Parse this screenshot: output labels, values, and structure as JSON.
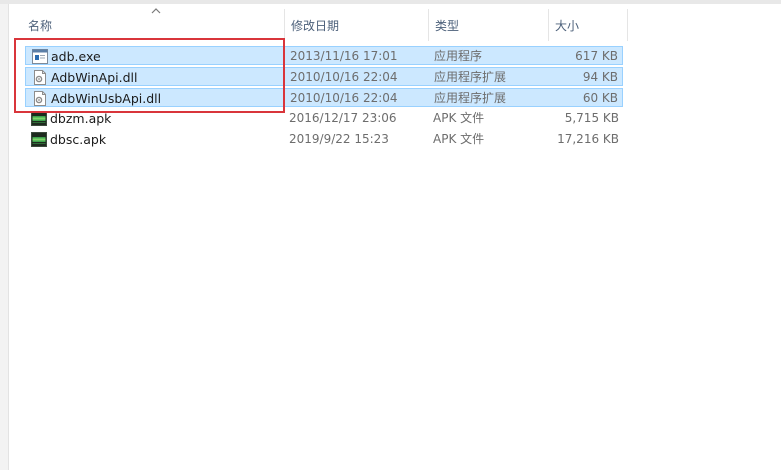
{
  "columns": {
    "name": "名称",
    "date": "修改日期",
    "type": "类型",
    "size": "大小"
  },
  "files": [
    {
      "name": "adb.exe",
      "date": "2013/11/16 17:01",
      "type": "应用程序",
      "size": "617 KB",
      "icon": "exe-icon",
      "selected": true
    },
    {
      "name": "AdbWinApi.dll",
      "date": "2010/10/16 22:04",
      "type": "应用程序扩展",
      "size": "94 KB",
      "icon": "dll-icon",
      "selected": true
    },
    {
      "name": "AdbWinUsbApi.dll",
      "date": "2010/10/16 22:04",
      "type": "应用程序扩展",
      "size": "60 KB",
      "icon": "dll-icon",
      "selected": true
    },
    {
      "name": "dbzm.apk",
      "date": "2016/12/17 23:06",
      "type": "APK 文件",
      "size": "5,715 KB",
      "icon": "apk-icon",
      "selected": false
    },
    {
      "name": "dbsc.apk",
      "date": "2019/9/22 15:23",
      "type": "APK 文件",
      "size": "17,216 KB",
      "icon": "apk-icon",
      "selected": false
    }
  ],
  "colors": {
    "selection_fill": "#cce8ff",
    "selection_border": "#99d1ff",
    "highlight_red": "#d9353b"
  }
}
